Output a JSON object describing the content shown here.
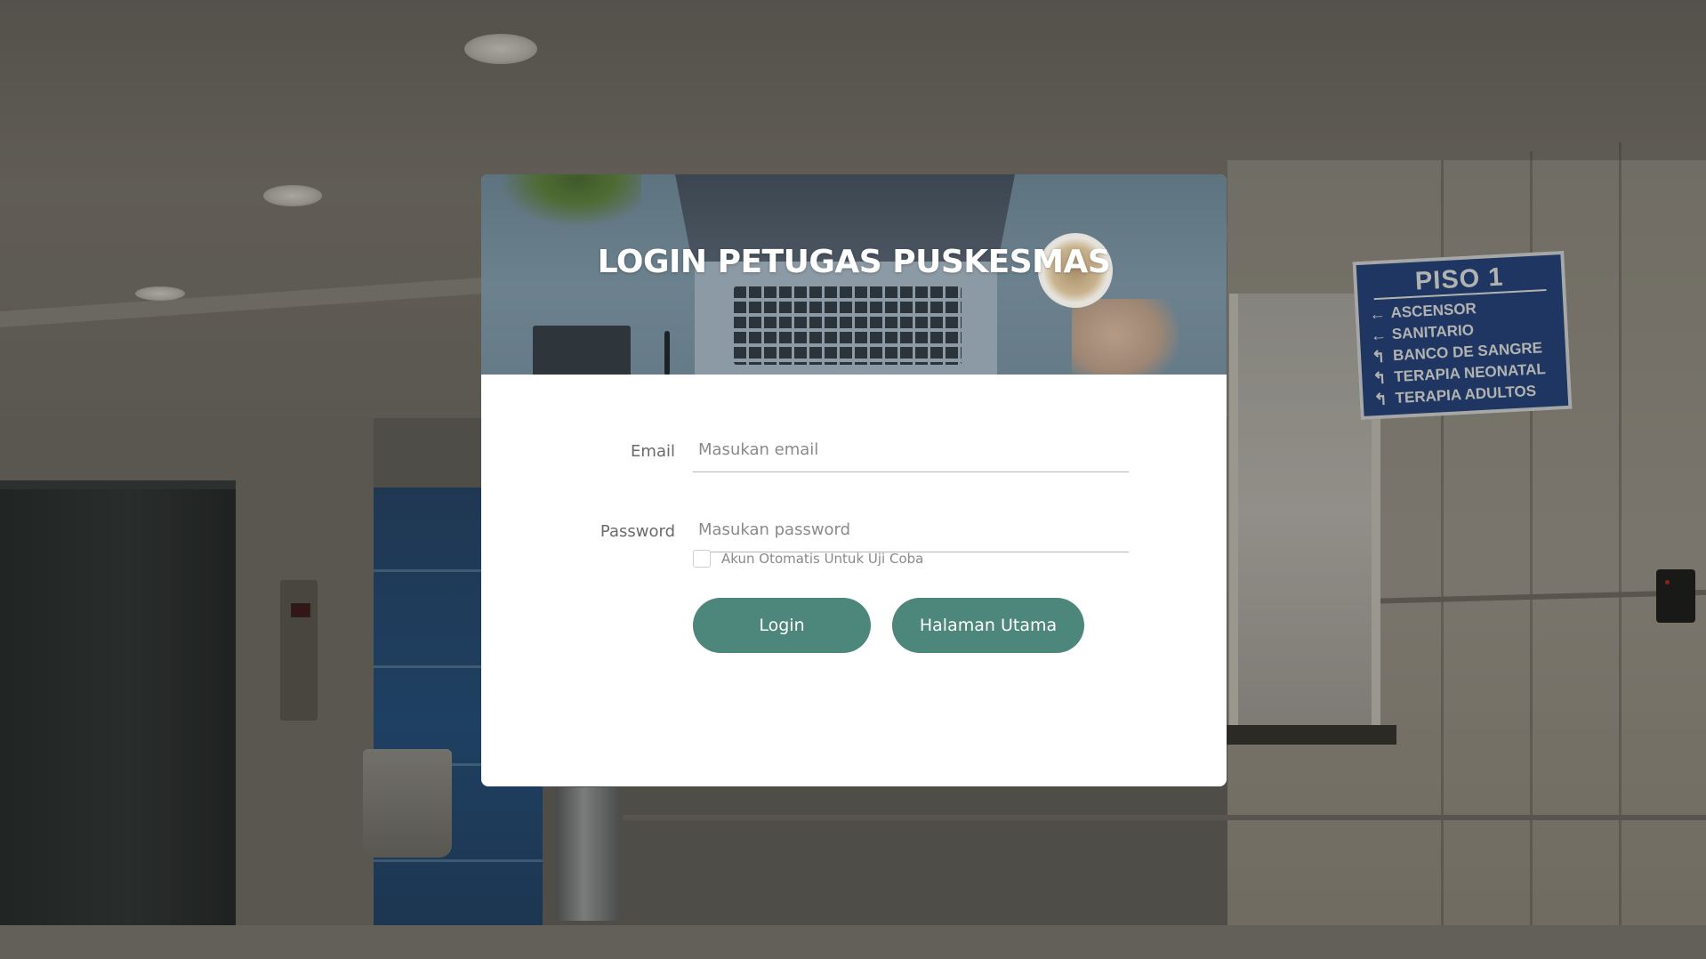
{
  "login": {
    "title": "LOGIN PETUGAS PUSKESMAS",
    "email_label": "Email",
    "email_placeholder": "Masukan email",
    "email_value": "",
    "password_label": "Password",
    "password_placeholder": "Masukan password",
    "password_value": "",
    "auto_account_label": "Akun Otomatis Untuk Uji Coba",
    "auto_account_checked": false,
    "login_button": "Login",
    "home_button": "Halaman Utama"
  },
  "background_sign": {
    "title": "PISO 1",
    "items": [
      {
        "arrow": "left-arrow-icon",
        "label": "ASCENSOR"
      },
      {
        "arrow": "left-arrow-icon",
        "label": "SANITARIO"
      },
      {
        "arrow": "up-turn-arrow-icon",
        "label": "BANCO DE SANGRE"
      },
      {
        "arrow": "up-turn-arrow-icon",
        "label": "TERAPIA NEONATAL"
      },
      {
        "arrow": "up-turn-arrow-icon",
        "label": "TERAPIA ADULTOS"
      }
    ]
  },
  "colors": {
    "primary_button": "#4d877b",
    "card_background": "#ffffff",
    "header_tint": "#667b88",
    "sign_background": "#1b3c7a"
  }
}
